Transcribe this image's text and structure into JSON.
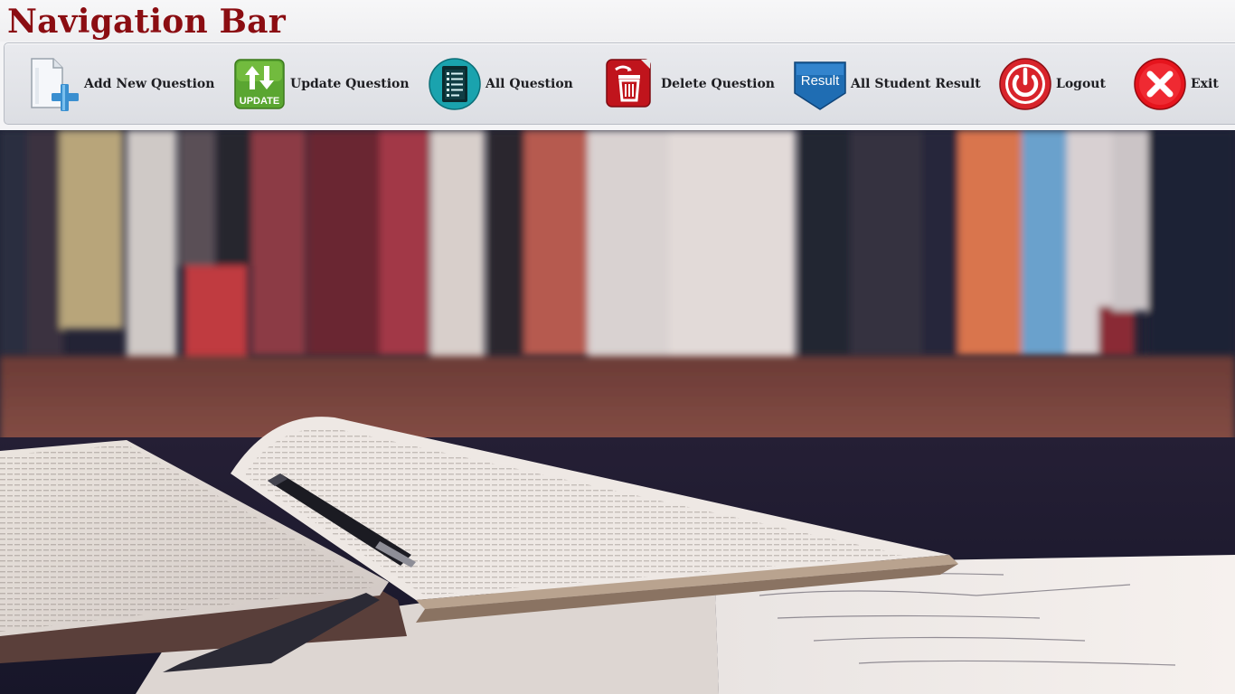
{
  "header": {
    "title": "Navigation Bar"
  },
  "nav": {
    "items": [
      {
        "label": "Add New Question",
        "icon": "add-document-icon"
      },
      {
        "label": "Update Question",
        "icon": "update-icon"
      },
      {
        "label": "All Question",
        "icon": "question-list-icon"
      },
      {
        "label": "Delete Question",
        "icon": "trash-icon"
      },
      {
        "label": "All Student Result",
        "icon": "result-badge-icon",
        "icon_text": "Result"
      },
      {
        "label": "Logout",
        "icon": "power-icon"
      },
      {
        "label": "Exit",
        "icon": "close-icon"
      }
    ]
  },
  "colors": {
    "title": "#8b0d12",
    "toolbar_top": "#e9eaee",
    "toolbar_bottom": "#dcdee3",
    "update_green": "#4c9a2a",
    "teal": "#1a9ba7",
    "delete_red": "#c0141c",
    "result_blue": "#1f6db3",
    "power_red": "#d8242b"
  },
  "background": {
    "image": "books-on-desk-photo"
  }
}
